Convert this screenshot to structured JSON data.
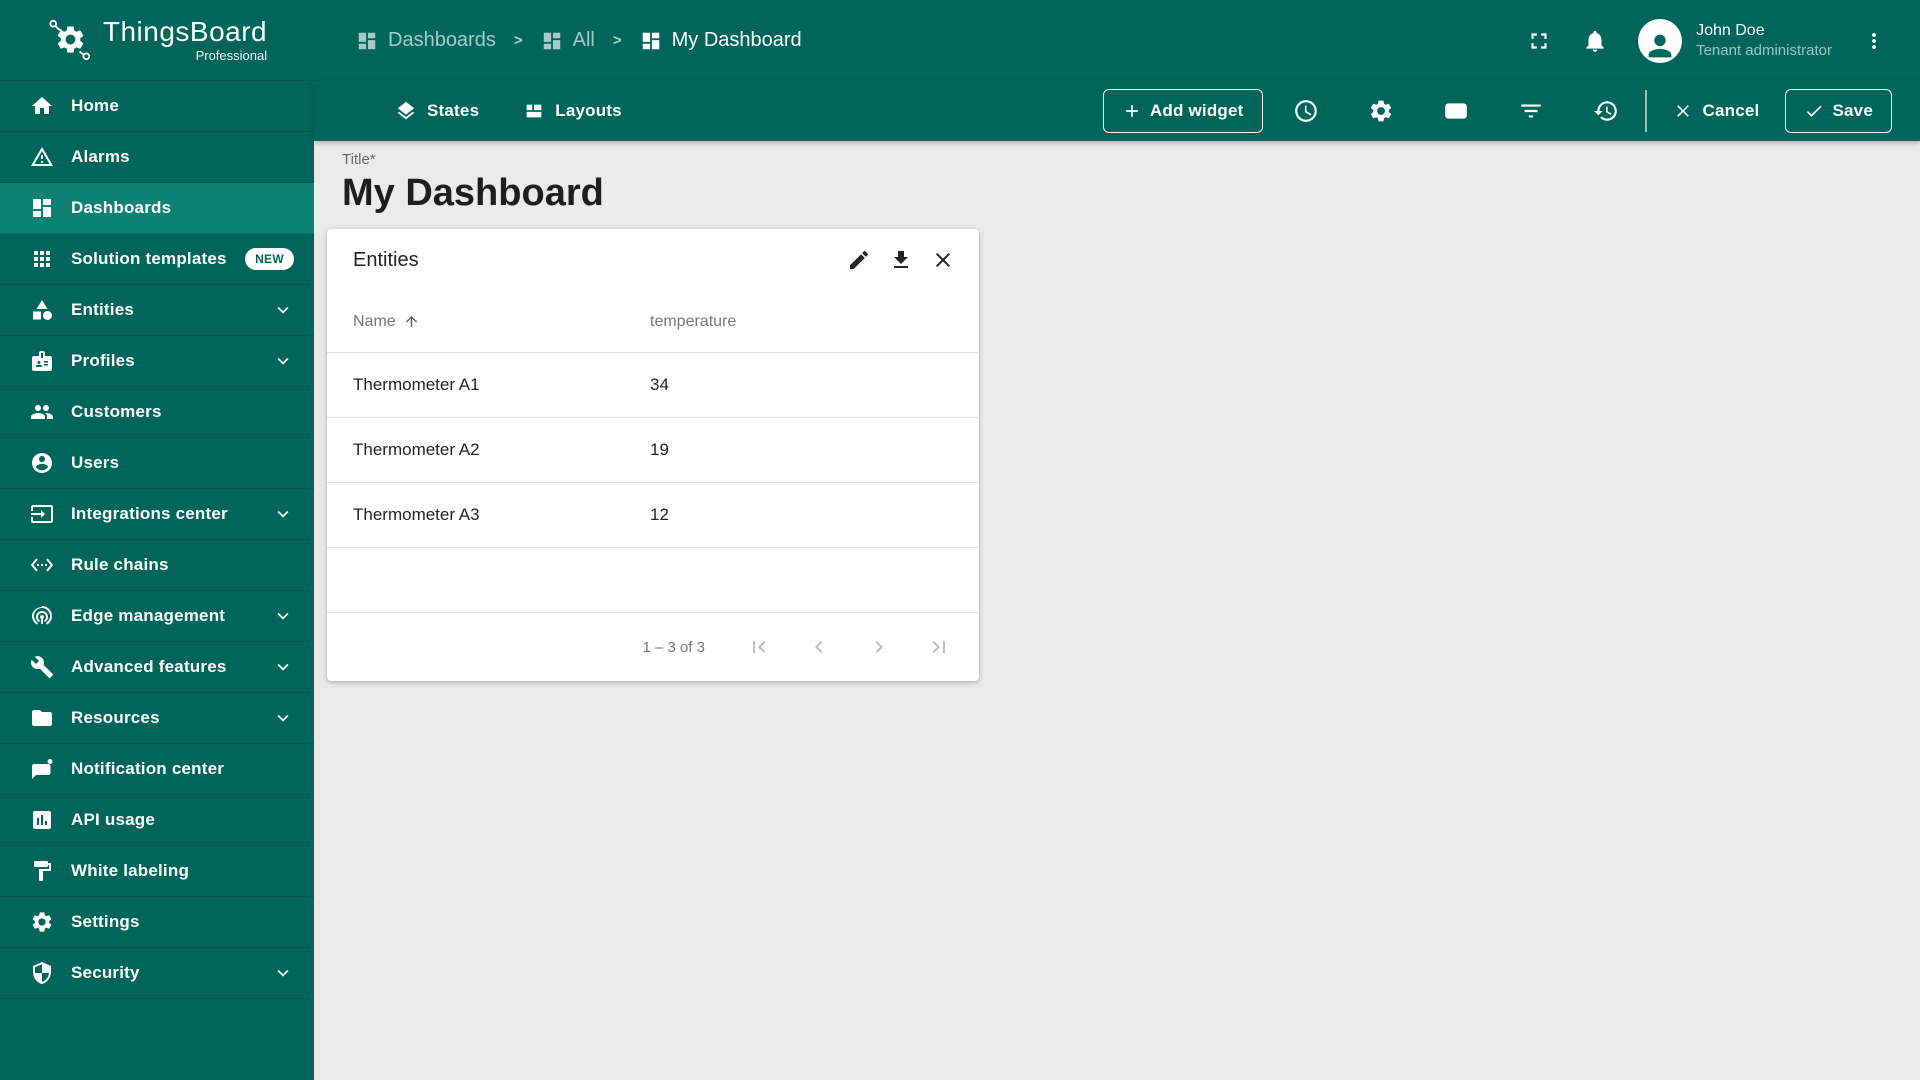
{
  "app": {
    "logo_title": "ThingsBoard",
    "logo_subtitle": "Professional"
  },
  "theme": {
    "primary": "#00655a",
    "primary_light": "#0d8173",
    "content_bg": "#ebebeb"
  },
  "sidebar": {
    "items": [
      {
        "label": "Home"
      },
      {
        "label": "Alarms"
      },
      {
        "label": "Dashboards",
        "selected": true
      },
      {
        "label": "Solution templates",
        "badge": "NEW"
      },
      {
        "label": "Entities",
        "expandable": true
      },
      {
        "label": "Profiles",
        "expandable": true
      },
      {
        "label": "Customers"
      },
      {
        "label": "Users"
      },
      {
        "label": "Integrations center",
        "expandable": true
      },
      {
        "label": "Rule chains"
      },
      {
        "label": "Edge management",
        "expandable": true
      },
      {
        "label": "Advanced features",
        "expandable": true
      },
      {
        "label": "Resources",
        "expandable": true
      },
      {
        "label": "Notification center"
      },
      {
        "label": "API usage"
      },
      {
        "label": "White labeling"
      },
      {
        "label": "Settings"
      },
      {
        "label": "Security",
        "expandable": true
      }
    ]
  },
  "breadcrumb": {
    "separator": ">",
    "items": [
      {
        "label": "Dashboards"
      },
      {
        "label": "All"
      },
      {
        "label": "My Dashboard"
      }
    ]
  },
  "user": {
    "name": "John Doe",
    "role": "Tenant administrator"
  },
  "toolbar": {
    "states_label": "States",
    "layouts_label": "Layouts",
    "add_widget_label": "Add widget",
    "cancel_label": "Cancel",
    "save_label": "Save"
  },
  "dashboard": {
    "title_label": "Title*",
    "title_value": "My Dashboard"
  },
  "widget": {
    "title": "Entities",
    "columns": {
      "name": "Name",
      "value": "temperature"
    },
    "rows": [
      {
        "name": "Thermometer A1",
        "value": "34"
      },
      {
        "name": "Thermometer A2",
        "value": "19"
      },
      {
        "name": "Thermometer A3",
        "value": "12"
      }
    ],
    "pagination": {
      "range": "1 – 3 of 3"
    }
  }
}
